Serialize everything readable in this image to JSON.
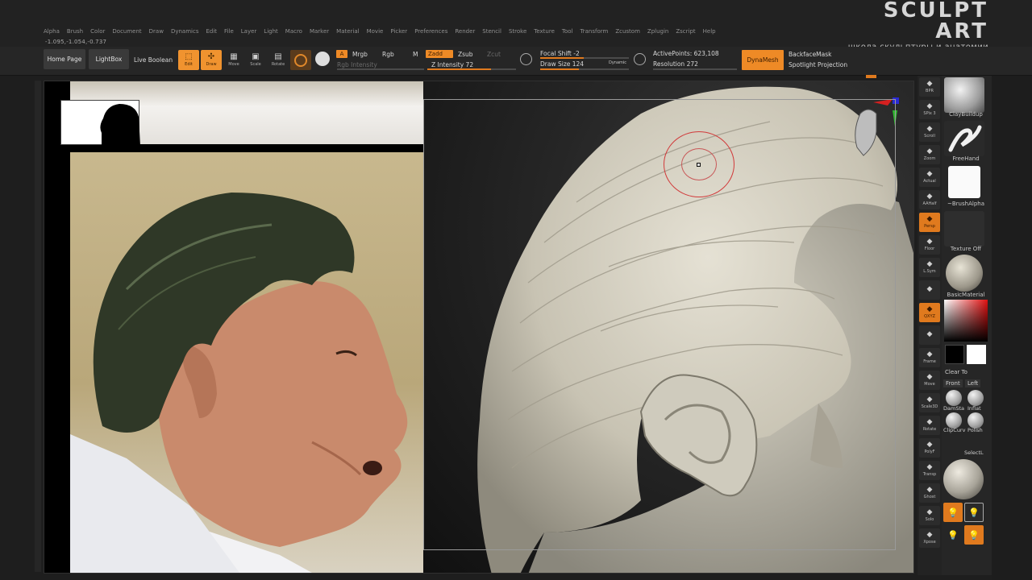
{
  "logo": {
    "title": "SCULPT ART",
    "subtitle": "школа скульптуры и анатомии"
  },
  "menu": [
    "Alpha",
    "Brush",
    "Color",
    "Document",
    "Draw",
    "Dynamics",
    "Edit",
    "File",
    "Layer",
    "Light",
    "Macro",
    "Marker",
    "Material",
    "Movie",
    "Picker",
    "Preferences",
    "Render",
    "Stencil",
    "Stroke",
    "Texture",
    "Tool",
    "Transform",
    "Zcustom",
    "Zplugin",
    "Zscript",
    "Help"
  ],
  "coords": "-1.095,-1.054,-0.737",
  "toolbar": {
    "home_page": "Home Page",
    "lightbox": "LightBox",
    "live_boolean": "Live Boolean",
    "edit": "Edit",
    "draw": "Draw",
    "move": "Move",
    "scale": "Scale",
    "rotate": "Rotate",
    "a_label": "A",
    "mrgb": "Mrgb",
    "rgb": "Rgb",
    "m": "M",
    "rgb_intensity": "Rgb Intensity",
    "zadd": "Zadd",
    "zsub": "Zsub",
    "zcut": "Zcut",
    "z_intensity": "Z Intensity 72",
    "focal_shift": "Focal Shift -2",
    "draw_size": "Draw Size 124",
    "dynamic": "Dynamic",
    "active_points": "ActivePoints: 623,108",
    "resolution": "Resolution 272",
    "dynamesh": "DynaMesh",
    "backface_mask": "BackfaceMask",
    "spotlight_projection": "Spotlight Projection",
    "z_intensity_value": 72,
    "draw_size_value": 124,
    "focal_shift_value": -2
  },
  "right_tray": [
    {
      "icon": "bpr-icon",
      "label": "BPR"
    },
    {
      "icon": "spix-icon",
      "label": "SPix 3"
    },
    {
      "icon": "scroll-icon",
      "label": "Scroll"
    },
    {
      "icon": "zoom-icon",
      "label": "Zoom"
    },
    {
      "icon": "actual-icon",
      "label": "Actual"
    },
    {
      "icon": "aahalf-icon",
      "label": "AAHalf"
    },
    {
      "icon": "persp-icon",
      "label": "Persp"
    },
    {
      "icon": "floor-icon",
      "label": "Floor"
    },
    {
      "icon": "lsym-icon",
      "label": "L.Sym"
    },
    {
      "icon": "lock-icon",
      "label": ""
    },
    {
      "icon": "xyz-icon",
      "label": "QXYZ"
    },
    {
      "icon": "rotate-icon",
      "label": ""
    },
    {
      "icon": "frame-icon",
      "label": "Frame"
    },
    {
      "icon": "move-icon",
      "label": "Move"
    },
    {
      "icon": "zoom3d-icon",
      "label": "Scale3D"
    },
    {
      "icon": "rotate3d-icon",
      "label": "Rotate"
    },
    {
      "icon": "polyf-icon",
      "label": "PolyF"
    },
    {
      "icon": "transp-icon",
      "label": "Transp"
    },
    {
      "icon": "ghost-icon",
      "label": "Ghost"
    },
    {
      "icon": "solo-icon",
      "label": "Solo"
    },
    {
      "icon": "xpose-icon",
      "label": "Xpose"
    }
  ],
  "brush_panel": {
    "claybuildup": "ClayBuildup",
    "freehand": "FreeHand",
    "brush_alpha": "~BrushAlpha",
    "texture_off": "Texture Off",
    "basic_material": "BasicMaterial",
    "clear_to": "Clear To",
    "front": "Front",
    "left": "Left",
    "damstd": "DamSta",
    "inflat": "Inflat",
    "clipcurve": "ClipCurv",
    "polish": "Polish",
    "selectlasso": "SelectL",
    "dynamic": "Dynamic"
  },
  "colors": {
    "accent": "#e07a1e",
    "bg": "#1e1e1e",
    "sculpt": "#d7d3c5",
    "brush_ring": "#d13a3a"
  }
}
